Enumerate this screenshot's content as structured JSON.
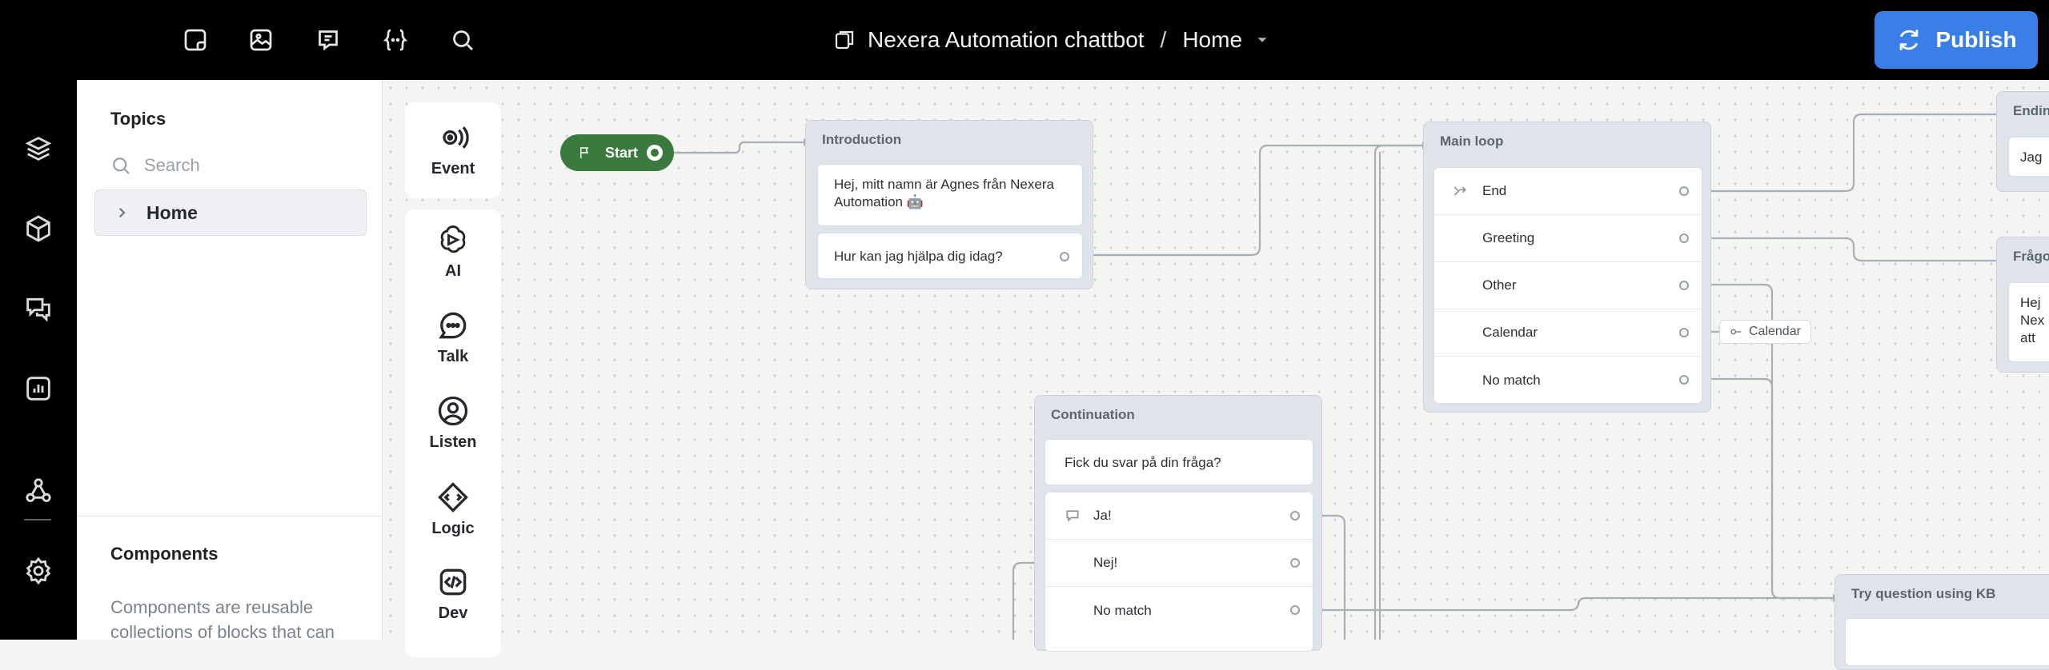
{
  "topbar": {
    "icons": [
      "sticky-note-icon",
      "image-icon",
      "comment-icon",
      "variable-icon",
      "search-icon"
    ],
    "breadcrumb": {
      "project": "Nexera Automation chattbot",
      "separator": "/",
      "page": "Home"
    },
    "publish_label": "Publish"
  },
  "rail": {
    "icons": [
      "layers-icon",
      "cube-icon",
      "conversations-icon",
      "analytics-icon",
      "integrations-icon",
      "settings-icon"
    ]
  },
  "sidebar": {
    "title": "Topics",
    "search_placeholder": "Search",
    "items": [
      {
        "label": "Home"
      }
    ],
    "components_title": "Components",
    "components_desc": "Components are reusable collections of blocks that can"
  },
  "palette": {
    "items": [
      {
        "label": "Event",
        "icon": "event-icon"
      },
      {
        "label": "AI",
        "icon": "ai-icon"
      },
      {
        "label": "Talk",
        "icon": "talk-icon"
      },
      {
        "label": "Listen",
        "icon": "listen-icon"
      },
      {
        "label": "Logic",
        "icon": "logic-icon"
      },
      {
        "label": "Dev",
        "icon": "dev-icon"
      }
    ]
  },
  "canvas": {
    "start_label": "Start",
    "introduction": {
      "title": "Introduction",
      "message": "Hej, mitt namn är Agnes från Nexera Automation 🤖",
      "question": "Hur kan jag hjälpa dig idag?"
    },
    "main_loop": {
      "title": "Main loop",
      "paths": [
        "End",
        "Greeting",
        "Other",
        "Calendar",
        "No match"
      ]
    },
    "calendar_chip": "Calendar",
    "continuation": {
      "title": "Continuation",
      "message": "Fick du svar på din fråga?",
      "choices": [
        "Ja!",
        "Nej!",
        "No match"
      ]
    },
    "try_kb": {
      "title": "Try question using KB"
    },
    "ending": {
      "title": "Endin",
      "text": "Jag"
    },
    "fraga": {
      "title": "Frågo",
      "lines": [
        "Hej",
        "Nex",
        "att"
      ]
    }
  }
}
